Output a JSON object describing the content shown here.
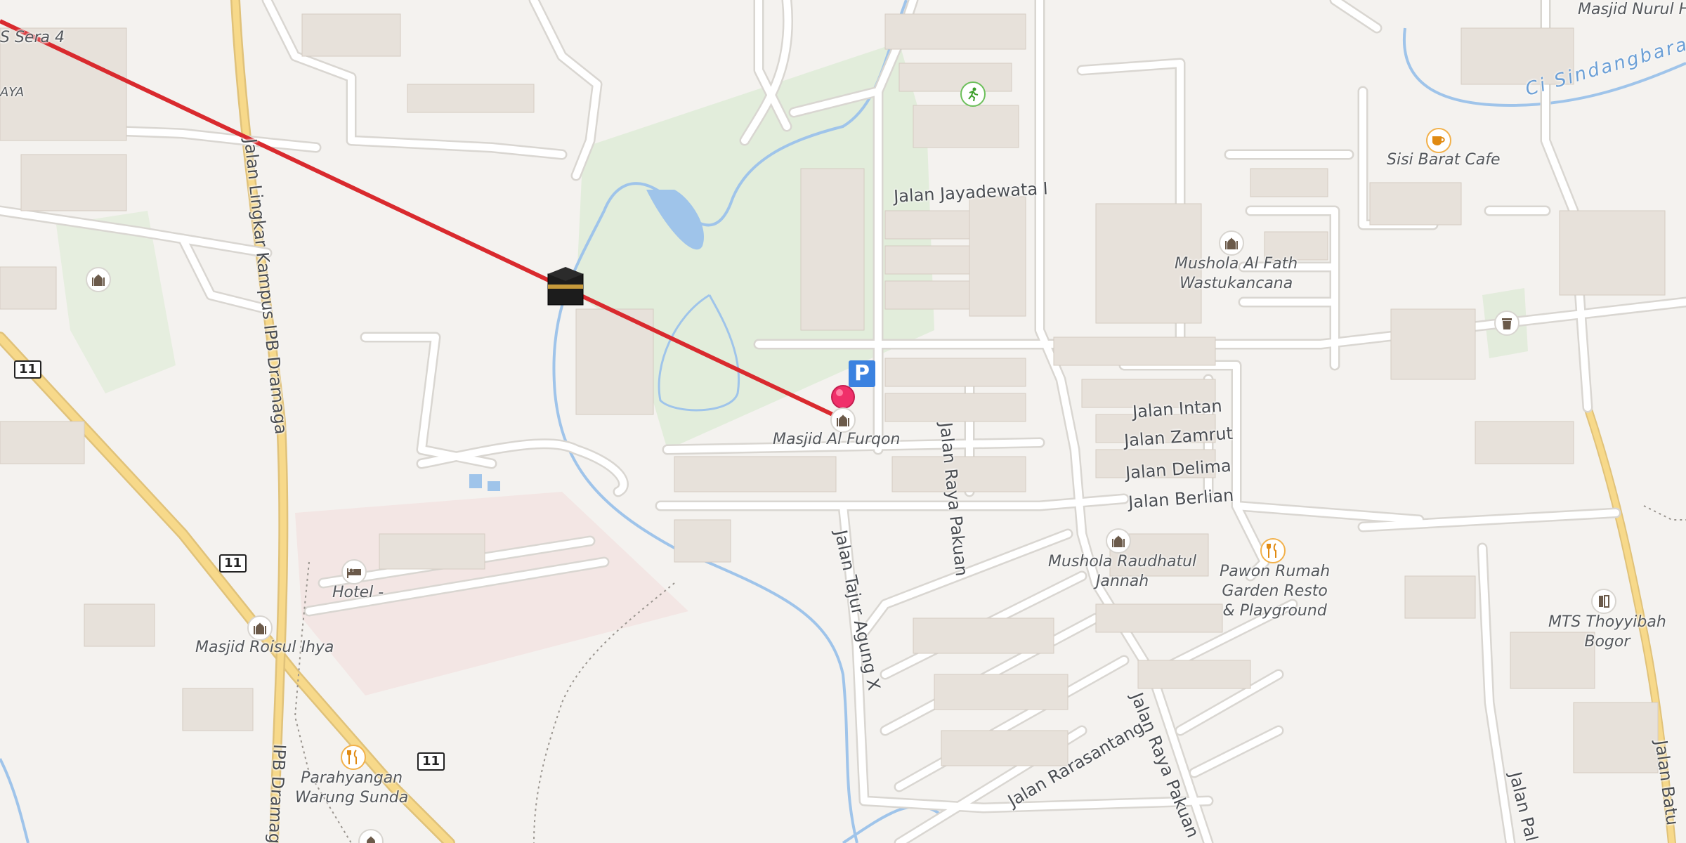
{
  "map": {
    "places": {
      "masjid_al_furqon": "Masjid Al Furqon",
      "masjid_roisul_ihya": "Masjid Roisul Ihya",
      "hotel": "Hotel -",
      "parahyangan": [
        "Parahyangan",
        "Warung Sunda"
      ],
      "mushola_al_fath": [
        "Mushola Al Fath",
        "Wastukancana"
      ],
      "mushola_raudhatul": [
        "Mushola Raudhatul",
        "Jannah"
      ],
      "pawon": [
        "Pawon Rumah",
        "Garden Resto",
        "& Playground"
      ],
      "sisi_barat": "Sisi Barat Cafe",
      "mts": [
        "MTS Thoyyibah",
        "Bogor"
      ],
      "masjid_nurul": "Masjid Nurul H",
      "sera4": "S Sera 4",
      "aya": "AYA"
    },
    "streets": {
      "jayadewata": "Jalan Jayadewata I",
      "raya_pakuan_1": "Jalan Raya Pakuan",
      "raya_pakuan_2": "Jalan Raya Pakuan",
      "intan": "Jalan Intan",
      "zamrut": "Jalan Zamrut",
      "delima": "Jalan Delima",
      "berlian": "Jalan Berlian",
      "tajur_agung": "Jalan Tajur Agung X",
      "rarasantang": "Jalan Rarasantang",
      "lingkar_kampus": "Jalan Lingkar Kampus IPB Dramaga",
      "ipb_dramaga": "IPB Dramaga",
      "jalan_pal": "Jalan Pal",
      "jalan_batu": "Jalan Batu"
    },
    "waterway": "Ci Sindangbarang",
    "route_shields": [
      "11",
      "11",
      "11"
    ],
    "parking_label": "P",
    "colors": {
      "qibla_line": "#d92a2e",
      "pin": "#f0306a",
      "water": "#9fc4ea",
      "road_major": "#f7d98a",
      "park": "#dde9d3"
    }
  }
}
